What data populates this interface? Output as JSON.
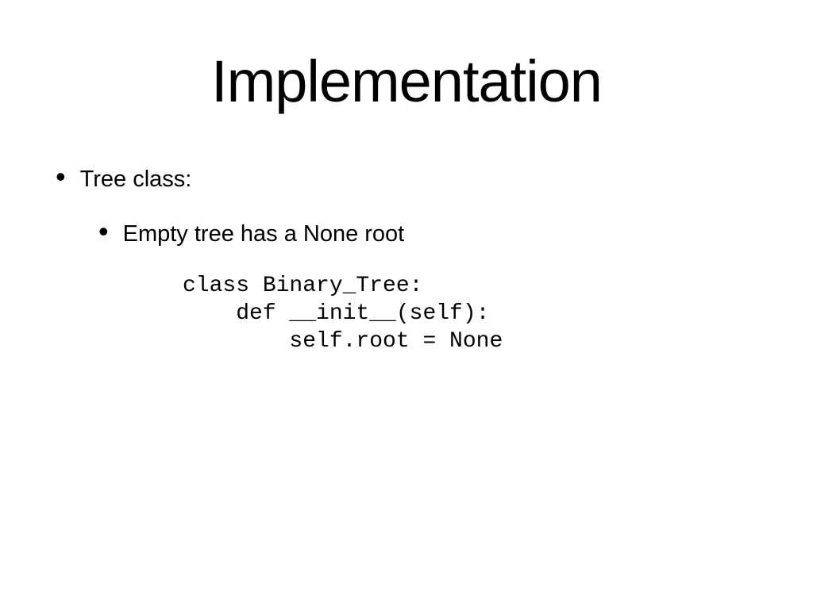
{
  "title": "Implementation",
  "bullet1": "Tree class:",
  "bullet2": "Empty tree has a None root",
  "code": "class Binary_Tree:\n    def __init__(self):\n        self.root = None"
}
